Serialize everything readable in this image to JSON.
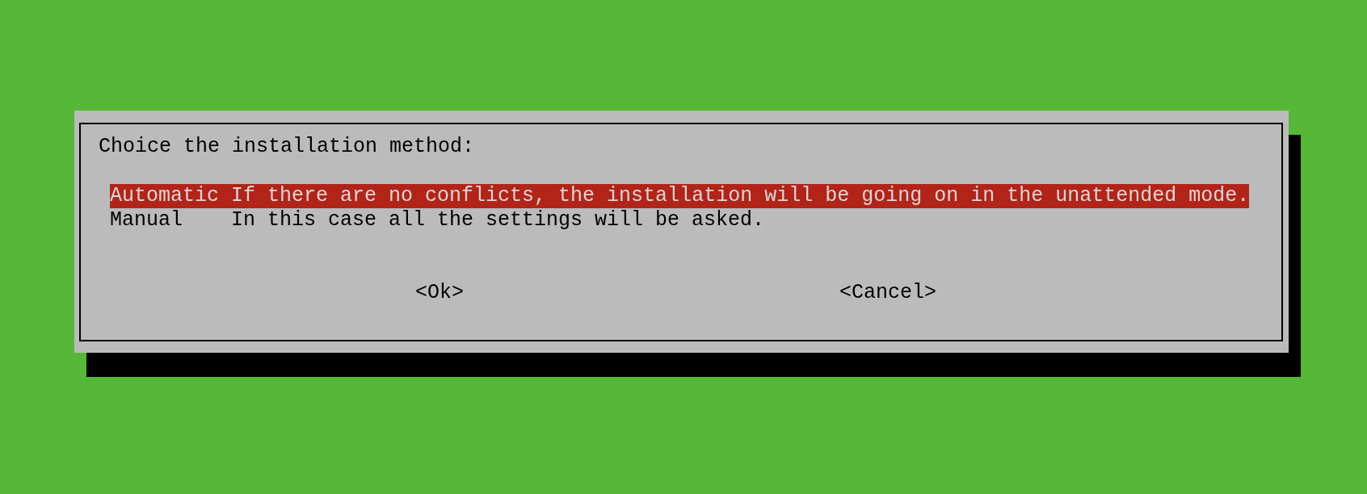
{
  "dialog": {
    "prompt": "Choice the installation method:",
    "options": [
      {
        "label": "Automatic",
        "description": "If there are no conflicts, the installation will be going on in the unattended mode.",
        "selected": true
      },
      {
        "label": "Manual",
        "description": "In this case all the settings will be asked.",
        "selected": false
      }
    ],
    "buttons": [
      {
        "label": "<Ok>",
        "selected": false
      },
      {
        "label": "<Cancel>",
        "selected": false
      }
    ]
  }
}
